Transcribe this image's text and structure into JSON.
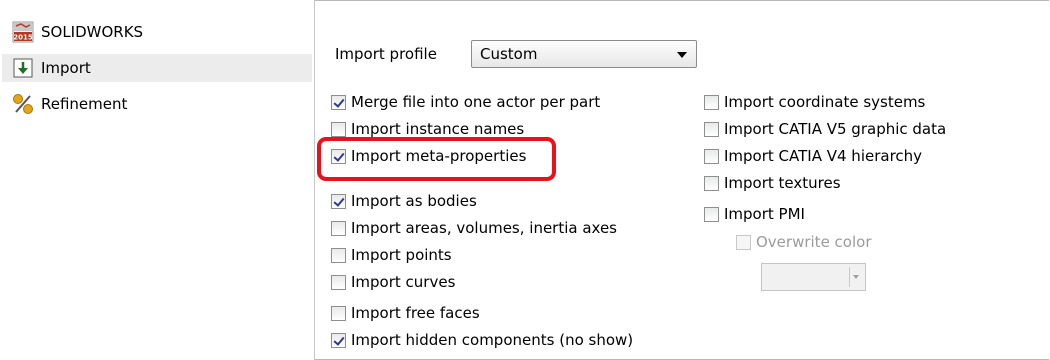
{
  "sidebar": {
    "items": [
      {
        "label": "SOLIDWORKS",
        "icon": "solidworks-2015-icon"
      },
      {
        "label": "Import",
        "icon": "import-arrow-icon"
      },
      {
        "label": "Refinement",
        "icon": "refinement-percent-icon"
      }
    ]
  },
  "import_profile": {
    "label": "Import profile",
    "value": "Custom"
  },
  "left_options": [
    {
      "label": "Merge file into one actor per part",
      "checked": true
    },
    {
      "label": "Import instance names",
      "checked": false
    },
    {
      "label": "Import meta-properties",
      "checked": true
    },
    {
      "label": "Import as bodies",
      "checked": true
    },
    {
      "label": "Import areas, volumes, inertia axes",
      "checked": false
    },
    {
      "label": "Import points",
      "checked": false
    },
    {
      "label": "Import curves",
      "checked": false
    },
    {
      "label": "Import free faces",
      "checked": false
    },
    {
      "label": "Import hidden components (no show)",
      "checked": true
    }
  ],
  "right_options": [
    {
      "label": "Import coordinate systems",
      "checked": false
    },
    {
      "label": "Import CATIA V5 graphic data",
      "checked": false
    },
    {
      "label": "Import CATIA V4 hierarchy",
      "checked": false
    },
    {
      "label": "Import textures",
      "checked": false
    },
    {
      "label": "Import PMI",
      "checked": false
    }
  ],
  "overwrite_color": {
    "label": "Overwrite color",
    "checked": false,
    "enabled": false
  },
  "colors": {
    "highlight": "#e8121b",
    "selected_bg": "#ececec",
    "check": "#2b3b8c"
  }
}
